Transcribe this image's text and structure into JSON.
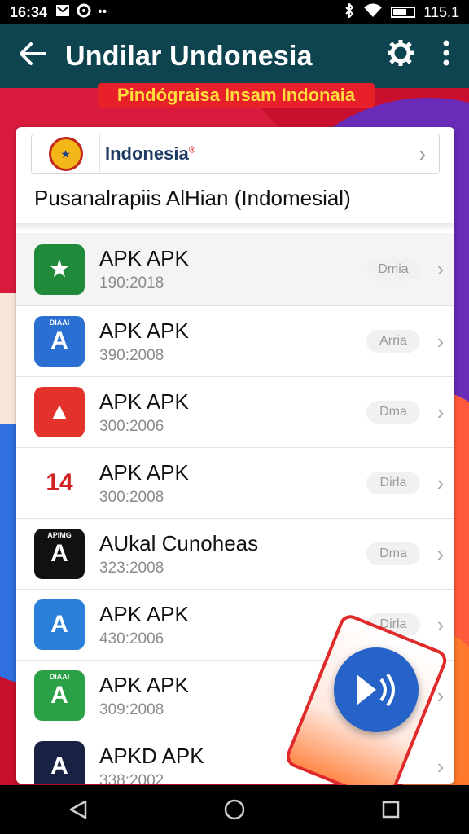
{
  "status_bar": {
    "time": "16:34",
    "battery_text": "115.1",
    "icons": [
      "gmail-icon",
      "sync-icon",
      "more-icon",
      "bluetooth-icon",
      "wifi-icon",
      "battery-icon"
    ]
  },
  "app_bar": {
    "title": "Undilar Undonesia",
    "back_icon": "arrow-left-icon",
    "actions": [
      "settings-icon",
      "overflow-menu-icon"
    ]
  },
  "banner": {
    "text": "Pindógraisa Insam Indonaia"
  },
  "header": {
    "country": "Indonesia",
    "country_suffix": "®",
    "subtitle": "Pusanalrapiis AlHian (Indomesial)"
  },
  "list": [
    {
      "name": "APK APK",
      "meta": "190:2018",
      "pill": "Dmia",
      "icon_bg": "#1f8a3a",
      "icon_glyph": "★",
      "icon_tag": ""
    },
    {
      "name": "APK APK",
      "meta": "390:2008",
      "pill": "Arria",
      "icon_bg": "#2a6fd1",
      "icon_glyph": "A",
      "icon_tag": "DIAAI"
    },
    {
      "name": "APK  APK",
      "meta": "300:2006",
      "pill": "Dma",
      "icon_bg": "#e3322b",
      "icon_glyph": "▲",
      "icon_tag": ""
    },
    {
      "name": "APK  APK",
      "meta": "300:2008",
      "pill": "Dirla",
      "icon_bg": "#ffffff",
      "icon_glyph": "14",
      "icon_tag": ""
    },
    {
      "name": "AUkal Cunoheas",
      "meta": "323:2008",
      "pill": "Dma",
      "icon_bg": "#111111",
      "icon_glyph": "A",
      "icon_tag": "APIMG"
    },
    {
      "name": "APK  APK",
      "meta": "430:2006",
      "pill": "Dirla",
      "icon_bg": "#2a7fd8",
      "icon_glyph": "A",
      "icon_tag": ""
    },
    {
      "name": "APK APK",
      "meta": "309:2008",
      "pill": "",
      "icon_bg": "#2aa146",
      "icon_glyph": "A",
      "icon_tag": "DIAAI"
    },
    {
      "name": "APKD APK",
      "meta": "338:2002",
      "pill": "",
      "icon_bg": "#1a2244",
      "icon_glyph": "A",
      "icon_tag": ""
    }
  ],
  "fab_icon": "play-sound-icon",
  "nav_bar": [
    "back-triangle-icon",
    "home-circle-icon",
    "recents-square-icon"
  ]
}
